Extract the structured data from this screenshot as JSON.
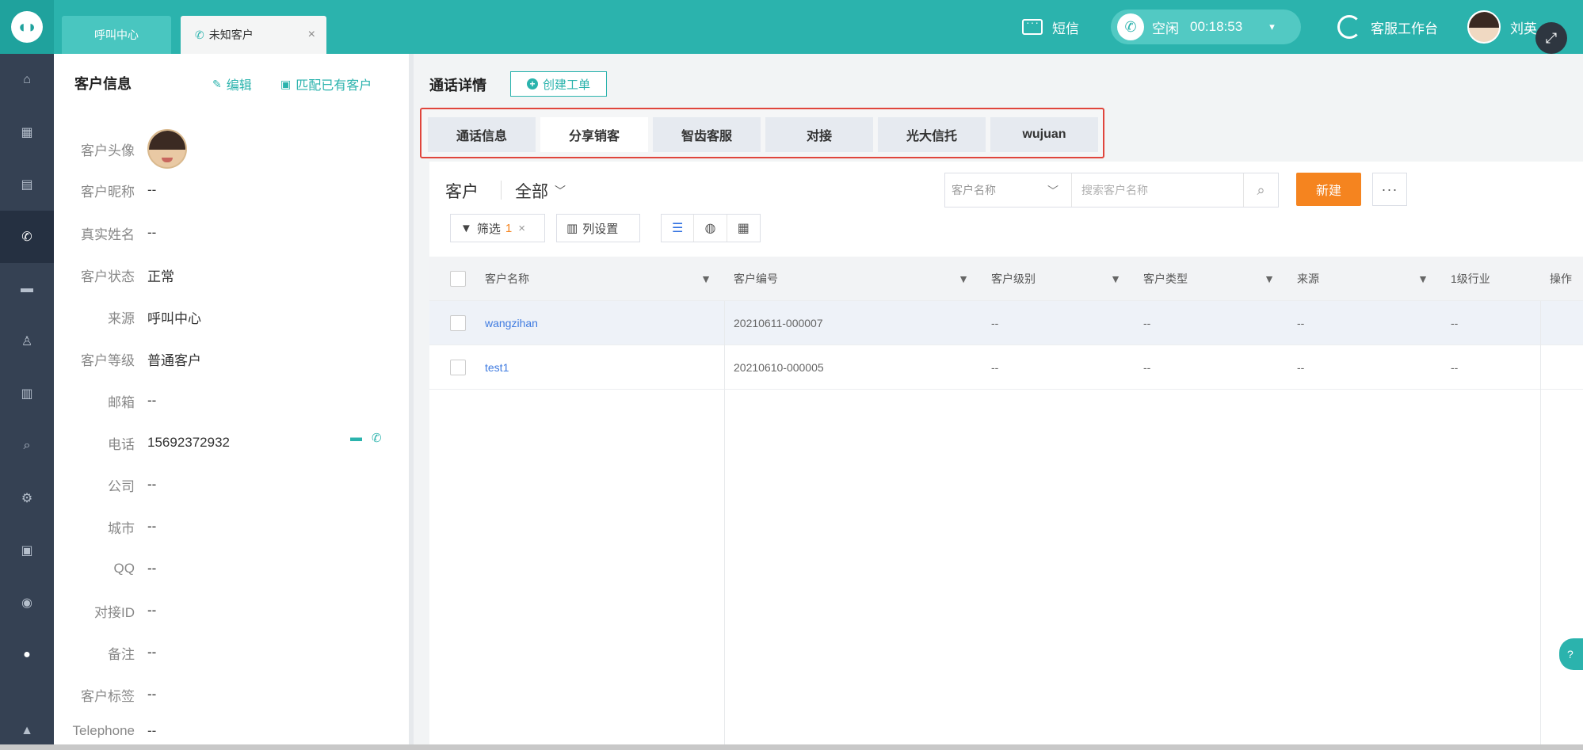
{
  "topbar": {
    "tabs": [
      {
        "label": "呼叫中心"
      },
      {
        "label": "未知客户"
      }
    ],
    "sms_label": "短信",
    "status_label": "空闲",
    "timer": "00:18:53",
    "workbench_label": "客服工作台",
    "user_name": "刘英"
  },
  "customer": {
    "title": "客户信息",
    "edit_label": "编辑",
    "match_label": "匹配已有客户",
    "fields": [
      {
        "key": "客户头像",
        "value": ""
      },
      {
        "key": "客户昵称",
        "value": "--"
      },
      {
        "key": "真实姓名",
        "value": "--"
      },
      {
        "key": "客户状态",
        "value": "正常"
      },
      {
        "key": "来源",
        "value": "呼叫中心"
      },
      {
        "key": "客户等级",
        "value": "普通客户"
      },
      {
        "key": "邮箱",
        "value": "--"
      },
      {
        "key": "电话",
        "value": "15692372932"
      },
      {
        "key": "公司",
        "value": "--"
      },
      {
        "key": "城市",
        "value": "--"
      },
      {
        "key": "QQ",
        "value": "--"
      },
      {
        "key": "对接ID",
        "value": "--"
      },
      {
        "key": "备注",
        "value": "--"
      },
      {
        "key": "客户标签",
        "value": "--"
      },
      {
        "key": "Telephone",
        "value": "--"
      }
    ]
  },
  "call": {
    "title": "通话详情",
    "create_order_label": "创建工单",
    "tabs": [
      {
        "label": "通话信息"
      },
      {
        "label": "分享销客"
      },
      {
        "label": "智齿客服"
      },
      {
        "label": "对接"
      },
      {
        "label": "光大信托"
      },
      {
        "label": "wujuan"
      }
    ],
    "active_tab": "分享销客"
  },
  "list": {
    "heading": "客户",
    "scope": "全部",
    "search_type": "客户名称",
    "search_placeholder": "搜索客户名称",
    "new_label": "新建",
    "more_label": "···",
    "filter_label": "筛选",
    "filter_count": "1",
    "col_settings_label": "列设置",
    "columns": [
      "客户名称",
      "客户编号",
      "客户级别",
      "客户类型",
      "来源",
      "1级行业",
      "操作"
    ],
    "rows": [
      {
        "name": "wangzihan",
        "code": "20210611-000007",
        "level": "--",
        "type": "--",
        "source": "--",
        "industry": "--"
      },
      {
        "name": "test1",
        "code": "20210610-000005",
        "level": "--",
        "type": "--",
        "source": "--",
        "industry": "--"
      }
    ]
  },
  "colors": {
    "brand": "#2bb3ad",
    "sidebar": "#354153",
    "accent_orange": "#f5841f",
    "link_blue": "#3f7be0",
    "highlight_red": "#e0453c"
  },
  "icons": {
    "logo": "tooth-logo-icon",
    "sidebar": [
      "home-icon",
      "grid-icon",
      "document-icon",
      "phone-icon",
      "chat-icon",
      "person-icon",
      "chart-icon",
      "search-icon",
      "settings-icon",
      "monitor-icon",
      "globe-icon",
      "user-circle-icon",
      "bell-icon"
    ]
  }
}
